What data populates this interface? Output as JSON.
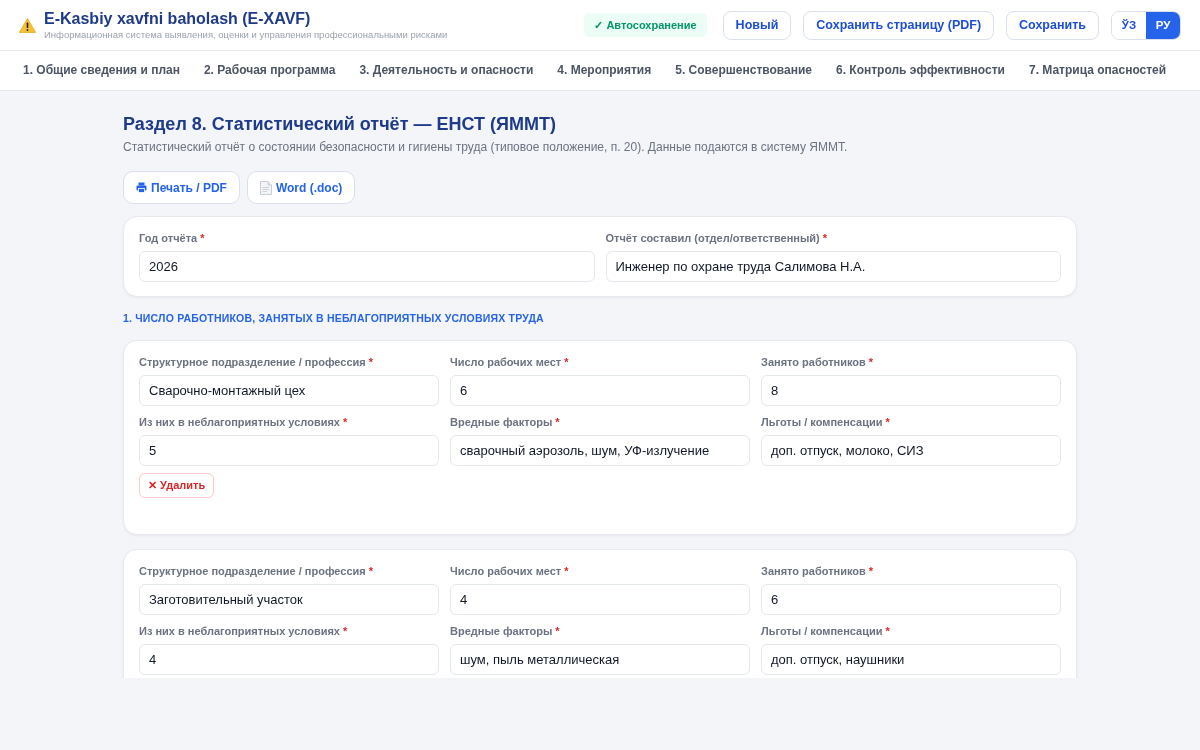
{
  "header": {
    "title": "E-Kasbiy xavfni baholash (E-XAVF)",
    "subtitle": "Информационная система выявления, оценки и управления профессиональными рисками",
    "autosave": "✓ Автосохранение",
    "buttons": [
      {
        "label": "Новый"
      },
      {
        "label": "Сохранить страницу (PDF)"
      },
      {
        "label": "Сохранить"
      }
    ],
    "languages": [
      {
        "label": "ЎЗ",
        "selected": false
      },
      {
        "label": "РУ",
        "selected": true
      }
    ]
  },
  "tabs": [
    {
      "label": "1. Общие сведения и план",
      "selected": false
    },
    {
      "label": "2. Рабочая программа",
      "selected": false
    },
    {
      "label": "3. Деятельность и опасности",
      "selected": false
    },
    {
      "label": "4. Мероприятия",
      "selected": false
    },
    {
      "label": "5. Совершенствование",
      "selected": false
    },
    {
      "label": "6. Контроль эффективности",
      "selected": false
    },
    {
      "label": "7. Матрица опасностей",
      "selected": false
    }
  ],
  "section": {
    "title": "Раздел 8. Статистический отчёт — ЕНСТ (ЯММТ)",
    "description": "Статистический отчёт о состоянии безопасности и гигиены труда (типовое положение, п. 20). Данные подаются в систему ЯММТ.",
    "export_buttons": [
      {
        "kind": "print",
        "label": "Печать / PDF"
      },
      {
        "kind": "word",
        "label": "Word (.doc)"
      }
    ]
  },
  "report_fields": [
    {
      "label": "Год отчёта",
      "required_mark": "*",
      "value": "2026"
    },
    {
      "label": "Отчёт составил (отдел/ответственный)",
      "required_mark": "*",
      "value": "Инженер по охране труда Салимова Н.А."
    }
  ],
  "workers_section": {
    "heading": "1. ЧИСЛО РАБОТНИКОВ, ЗАНЯТЫХ В НЕБЛАГОПРИЯТНЫХ УСЛОВИЯХ ТРУДА",
    "entries": [
      {
        "fields": [
          {
            "label": "Структурное подразделение / профессия",
            "required_mark": "*",
            "value": "Сварочно-монтажный цех"
          },
          {
            "label": "Число рабочих мест",
            "required_mark": "*",
            "value": "6"
          },
          {
            "label": "Занято работников",
            "required_mark": "*",
            "value": "8"
          },
          {
            "label": "Из них в неблагоприятных условиях",
            "required_mark": "*",
            "value": "5"
          },
          {
            "label": "Вредные факторы",
            "required_mark": "*",
            "value": "сварочный аэрозоль, шум, УФ-излучение"
          },
          {
            "label": "Льготы / компенсации",
            "required_mark": "*",
            "value": "доп. отпуск, молоко, СИЗ"
          }
        ],
        "delete_button": "✕ Удалить"
      },
      {
        "fields": [
          {
            "label": "Структурное подразделение / профессия",
            "required_mark": "*",
            "value": "Заготовительный участок"
          },
          {
            "label": "Число рабочих мест",
            "required_mark": "*",
            "value": "4"
          },
          {
            "label": "Занято работников",
            "required_mark": "*",
            "value": "6"
          },
          {
            "label": "Из них в неблагоприятных условиях",
            "required_mark": "*",
            "value": "4"
          },
          {
            "label": "Вредные факторы",
            "required_mark": "*",
            "value": "шум, пыль металлическая"
          },
          {
            "label": "Льготы / компенсации",
            "required_mark": "*",
            "value": "доп. отпуск, наушники"
          }
        ]
      }
    ]
  }
}
